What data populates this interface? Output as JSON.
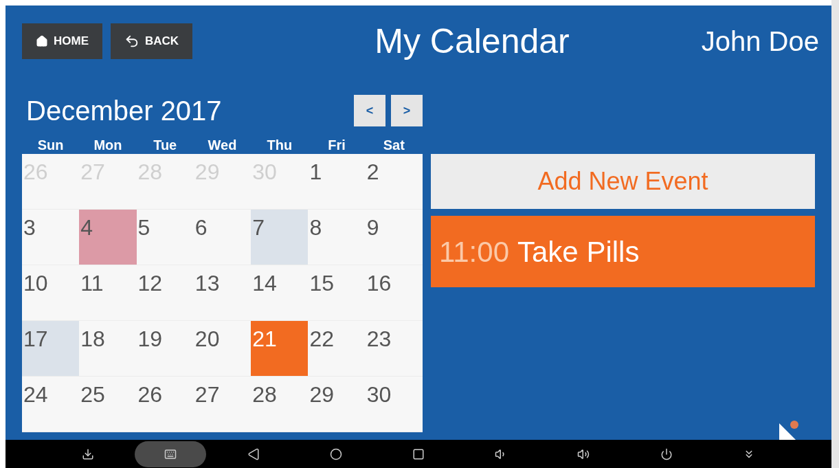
{
  "header": {
    "home": "HOME",
    "back": "BACK",
    "title": "My Calendar",
    "user": "John Doe"
  },
  "calendar": {
    "month": "December 2017",
    "prev": "<",
    "next": ">",
    "weekdays": [
      "Sun",
      "Mon",
      "Tue",
      "Wed",
      "Thu",
      "Fri",
      "Sat"
    ],
    "days": [
      {
        "label": "26",
        "muted": true,
        "selected": false
      },
      {
        "label": "27",
        "muted": true,
        "selected": false
      },
      {
        "label": "28",
        "muted": true,
        "selected": false
      },
      {
        "label": "29",
        "muted": true,
        "selected": false
      },
      {
        "label": "30",
        "muted": true,
        "selected": false
      },
      {
        "label": "1",
        "muted": false,
        "selected": false
      },
      {
        "label": "2",
        "muted": false,
        "selected": false
      },
      {
        "label": "3",
        "muted": false,
        "selected": false
      },
      {
        "label": "4",
        "muted": false,
        "selected": false,
        "color": "#dc9aa6"
      },
      {
        "label": "5",
        "muted": false,
        "selected": false
      },
      {
        "label": "6",
        "muted": false,
        "selected": false
      },
      {
        "label": "7",
        "muted": false,
        "selected": false,
        "color": "#dbe2ea"
      },
      {
        "label": "8",
        "muted": false,
        "selected": false
      },
      {
        "label": "9",
        "muted": false,
        "selected": false
      },
      {
        "label": "10",
        "muted": false,
        "selected": false
      },
      {
        "label": "11",
        "muted": false,
        "selected": false
      },
      {
        "label": "12",
        "muted": false,
        "selected": false
      },
      {
        "label": "13",
        "muted": false,
        "selected": false
      },
      {
        "label": "14",
        "muted": false,
        "selected": false
      },
      {
        "label": "15",
        "muted": false,
        "selected": false
      },
      {
        "label": "16",
        "muted": false,
        "selected": false
      },
      {
        "label": "17",
        "muted": false,
        "selected": false,
        "color": "#dbe2ea"
      },
      {
        "label": "18",
        "muted": false,
        "selected": false
      },
      {
        "label": "19",
        "muted": false,
        "selected": false
      },
      {
        "label": "20",
        "muted": false,
        "selected": false
      },
      {
        "label": "21",
        "muted": false,
        "selected": true
      },
      {
        "label": "22",
        "muted": false,
        "selected": false
      },
      {
        "label": "23",
        "muted": false,
        "selected": false
      },
      {
        "label": "24",
        "muted": false,
        "selected": false
      },
      {
        "label": "25",
        "muted": false,
        "selected": false
      },
      {
        "label": "26",
        "muted": false,
        "selected": false
      },
      {
        "label": "27",
        "muted": false,
        "selected": false
      },
      {
        "label": "28",
        "muted": false,
        "selected": false
      },
      {
        "label": "29",
        "muted": false,
        "selected": false
      },
      {
        "label": "30",
        "muted": false,
        "selected": false
      }
    ]
  },
  "add_event": "Add New Event",
  "events": [
    {
      "time": "11:00",
      "title": "Take Pills"
    }
  ],
  "nav_bar": [
    {
      "kind": "screenshot",
      "selected": false
    },
    {
      "kind": "keyboard",
      "selected": true
    },
    {
      "kind": "back",
      "selected": false
    },
    {
      "kind": "home",
      "selected": false
    },
    {
      "kind": "recent",
      "selected": false
    },
    {
      "kind": "volume-down",
      "selected": false
    },
    {
      "kind": "volume-up",
      "selected": false
    },
    {
      "kind": "power",
      "selected": false
    },
    {
      "kind": "collapse",
      "selected": false
    }
  ]
}
